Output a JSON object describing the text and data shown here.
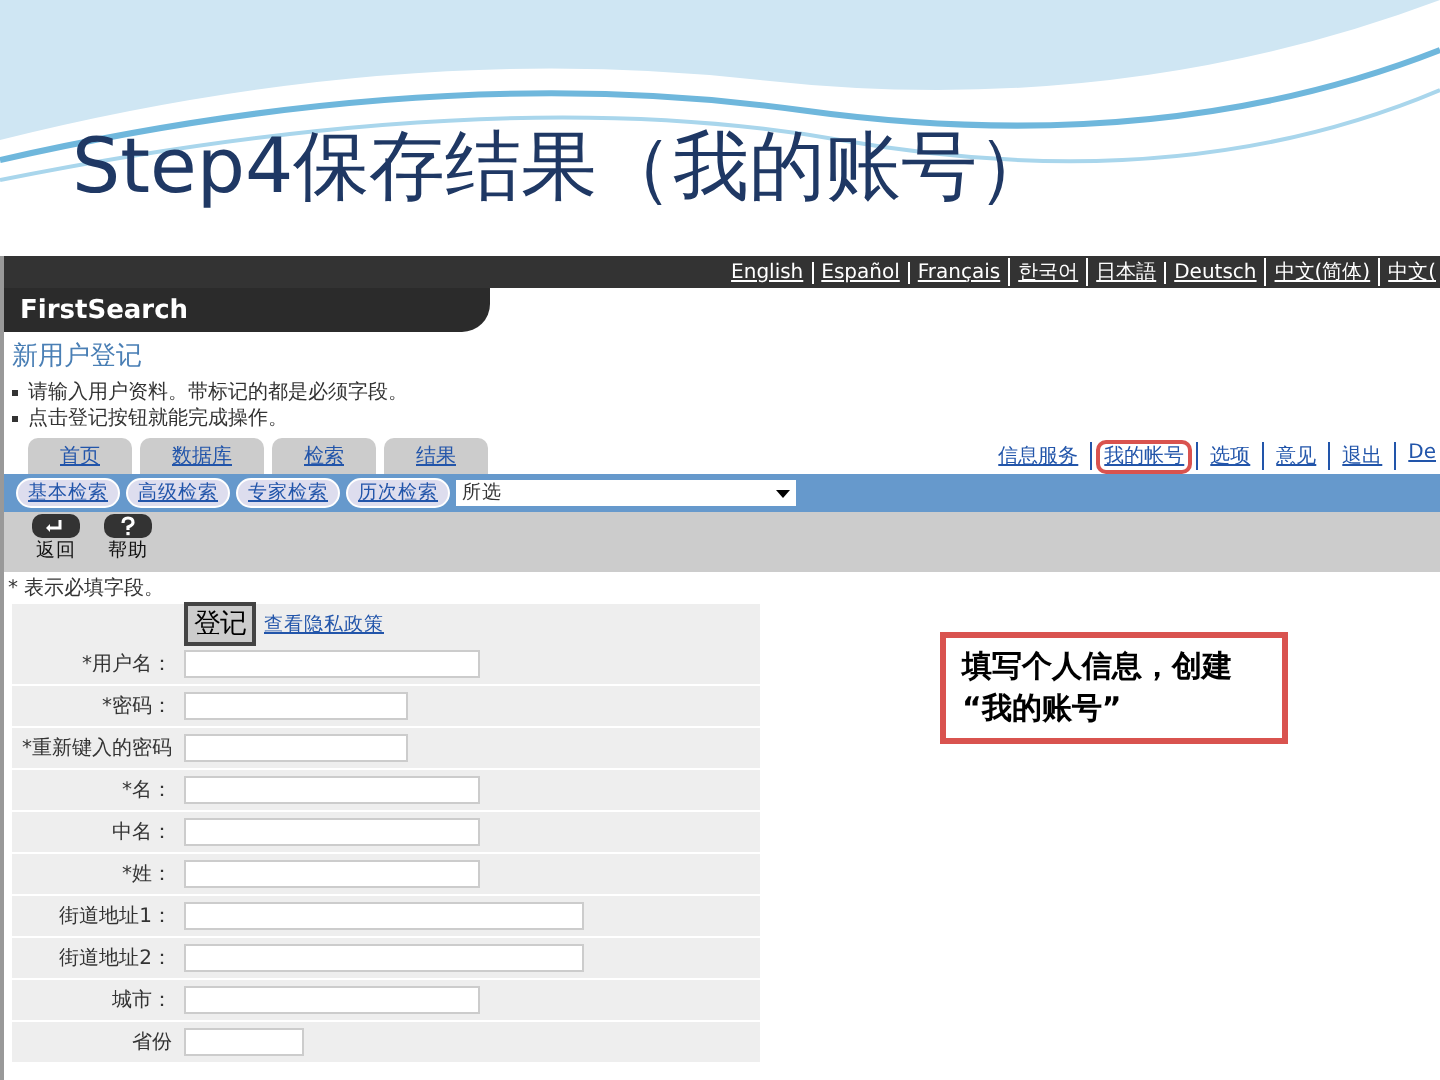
{
  "slide": {
    "title": "Step4保存结果（我的账号）"
  },
  "languages": [
    "English",
    "Español",
    "Français",
    "한국어",
    "日本語",
    "Deutsch",
    "中文(简体)",
    "中文("
  ],
  "logo": "FirstSearch",
  "heading": "新用户登记",
  "bullets": [
    "请输入用户资料。带标记的都是必须字段。",
    "点击登记按钮就能完成操作。"
  ],
  "tabs": [
    {
      "label": "首页",
      "selected": false
    },
    {
      "label": "数据库",
      "selected": false
    },
    {
      "label": "检索",
      "selected": false
    },
    {
      "label": "结果",
      "selected": false
    }
  ],
  "top_links": [
    {
      "label": "信息服务",
      "highlighted": false
    },
    {
      "label": "我的帐号",
      "highlighted": true
    },
    {
      "label": "选项",
      "highlighted": false
    },
    {
      "label": "意见",
      "highlighted": false
    },
    {
      "label": "退出",
      "highlighted": false
    },
    {
      "label": "De",
      "highlighted": false
    }
  ],
  "search_buttons": [
    "基本检索",
    "高级检索",
    "专家检索",
    "历次检索"
  ],
  "database_select": {
    "value": "所选"
  },
  "toolbar": [
    "返回",
    "帮助"
  ],
  "required_note": "* 表示必填字段。",
  "form": {
    "submit": "登记",
    "privacy_link": "查看隐私政策",
    "fields": [
      "*用户名：",
      "*密码：",
      "*重新键入的密码",
      "*名：",
      "中名：",
      "*姓：",
      "街道地址1：",
      "街道地址2：",
      "城市：",
      "省份"
    ]
  },
  "callout": "填写个人信息，创建 “我的账号”"
}
